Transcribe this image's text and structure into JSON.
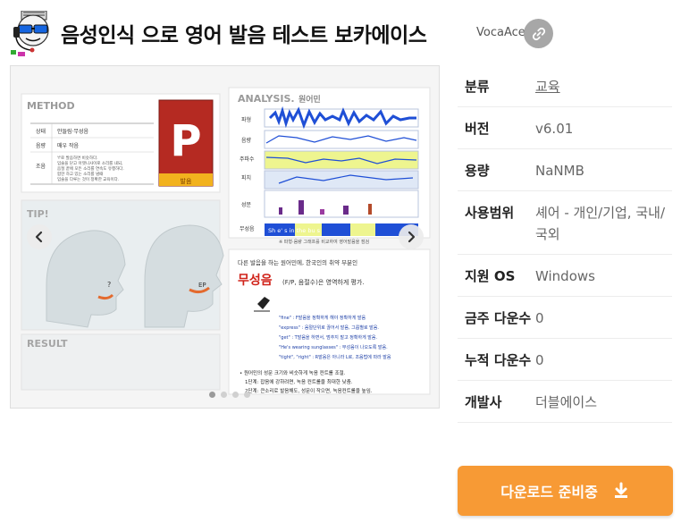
{
  "app": {
    "title": "음성인식 으로 영어 발음 테스트 보카에이스",
    "publisher": "VocaAce",
    "icon": "cartoon-face-headset-icon"
  },
  "gallery": {
    "slide": {
      "method_title": "METHOD",
      "method_rows": [
        {
          "label": "상태",
          "value": "안들림·무성음"
        },
        {
          "label": "음량",
          "value": "매우 작음"
        },
        {
          "label": "조음",
          "value": "'f'로 발음하면 비슷하다."
        }
      ],
      "method_note_2": "입술을 닫고 아랫니사이로 소리를 내되,",
      "method_note_3": "음절 끝에 모든 소리를 연속도 유행하다.",
      "method_note_4": "합한 하고 있는 소리를 냄때",
      "method_note_5": "입술을 다루는 것이 정확한 교육이다.",
      "letter": "P",
      "letter_caption": "발음",
      "tip_title": "TIP!",
      "ep_label": "EP",
      "result_title": "RESULT",
      "analysis_title": "ANALYSIS.",
      "analysis_sub": "원어민",
      "analysis_rows": [
        "파형",
        "음량",
        "주파수",
        "피치",
        "성문",
        "무성음"
      ],
      "phonemes": "Sh e' s in the bu s",
      "analysis_caption": "※ 파형·음량 그래프를 비교하여 영어발음을 점검",
      "note_intro": "다른 발음을 하는 원어민에, 한국인의 취약 부분인",
      "note_highlight": "무성음",
      "note_highlight_rest": "(F/P, 음절수)은 영역하게 평가.",
      "examples": [
        "\"fine\" : F발음을 정확하게 해야 정확하게 발음",
        "\"express\" : 음절단위로 끊어서 발음, 그룹별로 발음.",
        "\"get\" : T발음을 하면서, 멈추지 말고 정확하게 발음.",
        "\"He's wearing sunglasses\" : 무성음이 나오도록 발음.",
        "\"tight\", \"right\" : R발음은 아니라 L로, 조음법에 따라 발음"
      ],
      "bullet": "• 원어민의 성문 크기와 비슷하게 녹음 컨트롤 조절.",
      "step1": "1단계: 잡음에 강하려면, 녹음 컨트롤을 최대한 낮춤.",
      "step2": "2단계: 큰소리로 발음해도, 성문이 작으면, 녹음컨트롤을 높임."
    },
    "prev_icon": "chevron-left-icon",
    "next_icon": "chevron-right-icon",
    "dot_count": 4,
    "active_dot": 1
  },
  "details": {
    "category_label": "분류",
    "category_value": "교육",
    "version_label": "버전",
    "version_value": "v6.01",
    "size_label": "용량",
    "size_value": "NaNMB",
    "license_label": "사용범위",
    "license_value": "셰어 - 개인/기업, 국내/국외",
    "os_label": "지원 OS",
    "os_value": "Windows",
    "weekly_label": "금주 다운수",
    "weekly_value": "0",
    "total_label": "누적 다운수",
    "total_value": "0",
    "developer_label": "개발사",
    "developer_value": "더블에이스"
  },
  "download": {
    "label": "다운로드 준비중",
    "icon": "download-icon"
  },
  "colors": {
    "accent": "#f79a35",
    "link_button": "#a7a7a7",
    "waveform": "#1f4fd6",
    "highlight_band": "#eef58f",
    "letter_box": "#b52a22"
  }
}
